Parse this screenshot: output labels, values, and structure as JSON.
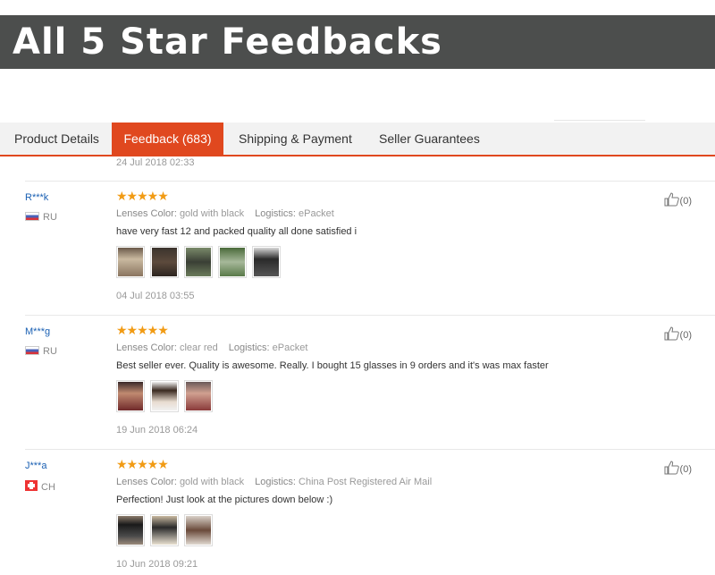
{
  "banner": {
    "title": "All 5 Star Feedbacks"
  },
  "tabs": [
    {
      "label": "Product Details"
    },
    {
      "label": "Feedback (683)",
      "active": true
    },
    {
      "label": "Shipping & Payment"
    },
    {
      "label": "Seller Guarantees"
    }
  ],
  "previous_date": "24 Jul 2018 02:33",
  "reviews": [
    {
      "name": "R***k",
      "country": "RU",
      "flag": "russia-flag",
      "stars": "★★★★★",
      "rating": 5,
      "attr1_key": "Lenses Color:",
      "attr1_val": "gold with black",
      "attr2_key": "Logistics:",
      "attr2_val": "ePacket",
      "text": "have very fast 12 and packed quality all done satisfied i",
      "likes": "(0)",
      "date": "04 Jul 2018 03:55"
    },
    {
      "name": "M***g",
      "country": "RU",
      "flag": "russia-flag",
      "stars": "★★★★★",
      "rating": 5,
      "attr1_key": "Lenses Color:",
      "attr1_val": "clear red",
      "attr2_key": "Logistics:",
      "attr2_val": "ePacket",
      "text": "Best seller ever. Quality is awesome. Really. I bought 15 glasses in 9 orders and it's was max faster",
      "likes": "(0)",
      "date": "19 Jun 2018 06:24"
    },
    {
      "name": "J***a",
      "country": "CH",
      "flag": "switzerland-flag",
      "stars": "★★★★★",
      "rating": 5,
      "attr1_key": "Lenses Color:",
      "attr1_val": "gold with black",
      "attr2_key": "Logistics:",
      "attr2_val": "China Post Registered Air Mail",
      "text": "Perfection! Just look at the pictures down below :)",
      "likes": "(0)",
      "date": "10 Jun 2018 09:21"
    }
  ],
  "colors": {
    "accent": "#e0481f",
    "banner": "#4c4e4d",
    "star": "#f19b14",
    "name": "#1a60b3"
  }
}
